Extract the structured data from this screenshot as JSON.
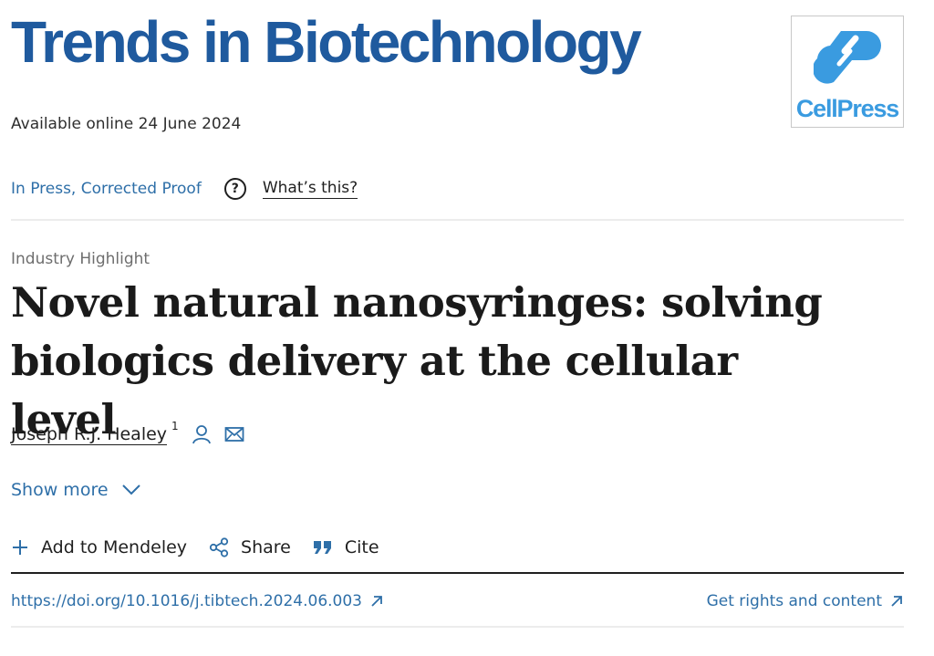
{
  "journal": {
    "title": "Trends in Biotechnology"
  },
  "publisher": {
    "logo_text": "CellPress",
    "accent_color": "#3a9be0"
  },
  "availability": {
    "text": "Available online 24 June 2024"
  },
  "status": {
    "label": "In Press, Corrected Proof",
    "help_label": "What’s this?",
    "help_icon": "question-circle-icon"
  },
  "article": {
    "type": "Industry Highlight",
    "title": "Novel natural nanosyringes: solving biologics delivery at the cellular level"
  },
  "author": {
    "name": "Joseph R.J. Healey",
    "affiliation_marker": "1",
    "icons": [
      "person-icon",
      "envelope-icon"
    ]
  },
  "show_more": {
    "label": "Show more"
  },
  "actions": {
    "mendeley": "Add to Mendeley",
    "share": "Share",
    "cite": "Cite"
  },
  "links": {
    "doi": "https://doi.org/10.1016/j.tibtech.2024.06.003",
    "rights": "Get rights and content"
  },
  "colors": {
    "journal_blue": "#1f5a9e",
    "link_blue": "#2e6fa8"
  }
}
